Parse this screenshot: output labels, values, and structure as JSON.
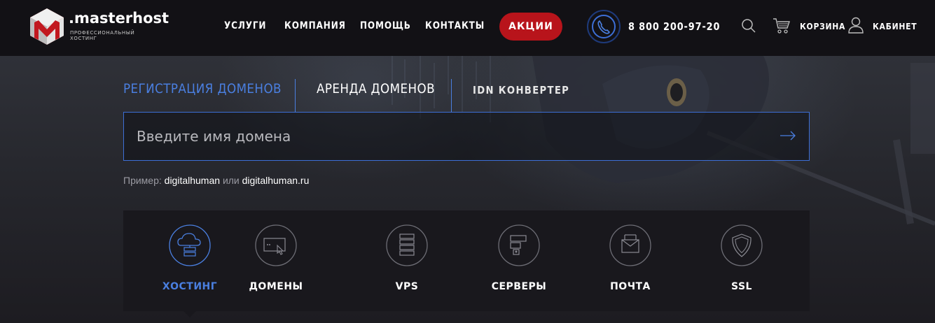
{
  "brand": {
    "name": ".masterhost",
    "tagline": "профессиональный хостинг",
    "accent_red": "#b8141b",
    "accent_blue": "#4a7fe0"
  },
  "nav": {
    "items": [
      {
        "label": "УСЛУГИ"
      },
      {
        "label": "КОМПАНИЯ"
      },
      {
        "label": "ПОМОЩЬ"
      },
      {
        "label": "КОНТАКТЫ"
      }
    ],
    "promo_label": "АКЦИИ",
    "phone": "8 800 200-97-20",
    "cart_label": "КОРЗИНА",
    "cabinet_label": "КАБИНЕТ"
  },
  "domain_tabs": {
    "registration": "РЕГИСТРАЦИЯ ДОМЕНОВ",
    "rent": "АРЕНДА ДОМЕНОВ",
    "idn": "IDN КОНВЕРТЕР",
    "active": "registration"
  },
  "search": {
    "placeholder": "Введите имя домена",
    "value": ""
  },
  "example": {
    "prefix": "Пример:",
    "value1": "digitalhuman",
    "joiner": "или",
    "value2": "digitalhuman.ru"
  },
  "services": {
    "active": "hosting",
    "items": [
      {
        "id": "hosting",
        "label": "ХОСТИНГ",
        "icon": "cloud-server-icon"
      },
      {
        "id": "domains",
        "label": "ДОМЕНЫ",
        "icon": "domain-browser-icon"
      },
      {
        "id": "vps",
        "label": "VPS",
        "icon": "vps-stack-icon"
      },
      {
        "id": "servers",
        "label": "СЕРВЕРЫ",
        "icon": "server-icon"
      },
      {
        "id": "mail",
        "label": "ПОЧТА",
        "icon": "mail-icon"
      },
      {
        "id": "ssl",
        "label": "SSL",
        "icon": "shield-icon"
      }
    ]
  }
}
